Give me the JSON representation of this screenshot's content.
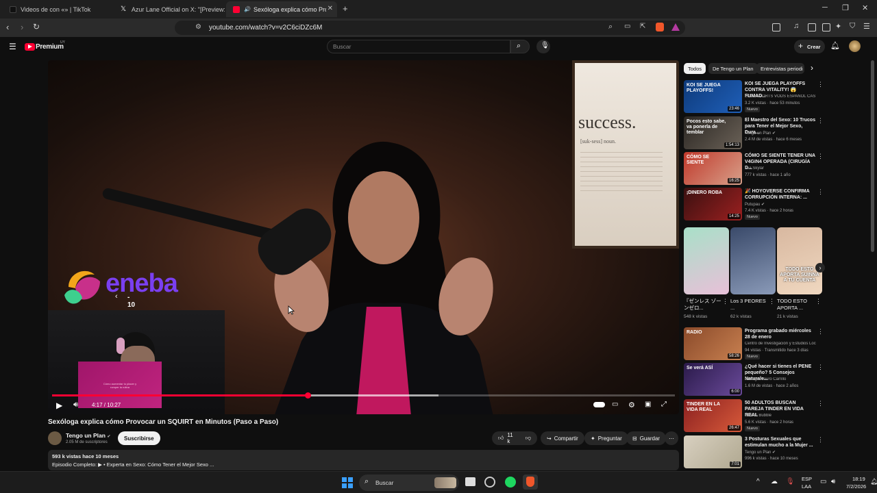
{
  "tabs": [
    {
      "title": "Videos de con «» | TikTok",
      "active": false
    },
    {
      "title": "Azur Lane Official on X: \"[Preview: Fr",
      "active": false
    },
    {
      "title": "Sexóloga explica cómo Provoc",
      "active": true
    }
  ],
  "address": {
    "url": "youtube.com/watch?v=v2C6ciDZc6M"
  },
  "yt": {
    "brand": "Premium",
    "region": "UY",
    "search_placeholder": "Buscar",
    "create_label": "Crear"
  },
  "video": {
    "poster_text": "success.",
    "poster_sub": "[suk-sess] noun.",
    "overlay_brand": "eneba",
    "skip_label": "- 10",
    "pink_text": "Cómo aumentar tu placer y romper la rutina",
    "time": "4:17 / 10:27",
    "progress": 0.41,
    "buffered": 0.62,
    "title": "Sexóloga explica cómo Provocar un SQUIRT en Minutos (Paso a Paso)"
  },
  "channel": {
    "name": "Tengo un Plan",
    "subs": "2.05 M de suscriptores",
    "subscribe_label": "Suscribirse"
  },
  "actions": {
    "likes": "11 k",
    "share": "Compartir",
    "ask": "Preguntar",
    "save": "Guardar"
  },
  "description": {
    "stats": "593 k vistas  hace 10 meses",
    "line": "Episodio Completo: ▶ • Experta en Sexo: Cómo Tener el Mejor Sexo ..."
  },
  "chips": [
    "Todos",
    "De Tengo un Plan",
    "Entrevistas periodi"
  ],
  "recs_top": [
    {
      "title": "KOI SE JUEGA PLAYOFFS CONTRA VITALITY! 😱FUMAD...",
      "channel": "LOL ESPORTS VODS ESPAÑOL CASTEO...",
      "views": "3.2 K vistas · hace 53 minutos",
      "badge": "Nuevo",
      "dur": "23:46",
      "thumb_text": "KOI SE JUEGA PLAYOFFS!",
      "colors": [
        "#0e3a7a",
        "#1f5fb8"
      ]
    },
    {
      "title": "El Maestro del Sexo: 10 Trucos para Tener el Mejor Sexo, Dura...",
      "channel": "Tengo un Plan ✔",
      "views": "2.4 M de vistas · hace 6 meses",
      "badge": "",
      "dur": "1:54:13",
      "thumb_text": "Pocos esto sabe, va ponerla de temblar",
      "colors": [
        "#2a2622",
        "#6b6258"
      ]
    },
    {
      "title": "CÓMO SE SIENTE TENER UNA V4GIN4 OPERADA (CIRUGÍA D...",
      "channel": "Mia Skylar",
      "views": "777 k vistas · hace 1 año",
      "badge": "",
      "dur": "16:25",
      "thumb_text": "CÓMO SE SIENTE",
      "colors": [
        "#c0392b",
        "#d8a08a"
      ]
    },
    {
      "title": "🎉 HOYOVERSE CONFIRMA CORRUPCIÓN INTERNA: ...",
      "channel": "Putupau ✔",
      "views": "7.4 K vistas · hace 2 horas",
      "badge": "Nuevo",
      "dur": "14:25",
      "thumb_text": "¡DINERO ROBA",
      "colors": [
        "#3a1010",
        "#9b2020"
      ]
    }
  ],
  "shorts": [
    {
      "title": "『ゼンレス ゾーンゼロ...",
      "views": "548 k vistas",
      "colors": [
        "#a8e0c8",
        "#e8c0d8"
      ]
    },
    {
      "title": "Los 3 PEORES ...",
      "views": "62 k vistas",
      "colors": [
        "#3a4a6a",
        "#8a9ab8"
      ]
    },
    {
      "title": "TODO ESTO APORTA ...",
      "views": "21 k vistas",
      "colors": [
        "#d8b8a0",
        "#f0d8c0"
      ],
      "overlay": "TODO ESTO APORTA SUINNA A TU CUENTA"
    }
  ],
  "recs_bottom": [
    {
      "title": "Programa grabado miércoles 28 de enero",
      "channel": "Centro de Investigación y Estudios Loca...",
      "views": "94 vistas · Transmitido hace 3 días",
      "badge": "Nuevo",
      "dur": "58:26",
      "thumb_text": "RADIO",
      "colors": [
        "#8a4a2a",
        "#c88050"
      ]
    },
    {
      "title": "¿Qué hacer si tienes el PENE pequeño? 5 Consejos Naturale...",
      "channel": "Urólogo Mauro Carrillo",
      "views": "1.6 M de vistas · hace 2 años",
      "badge": "",
      "dur": "6:00",
      "thumb_text": "Se verá ASÍ",
      "colors": [
        "#2a1a4a",
        "#6a4a9a"
      ]
    },
    {
      "title": "50 ADULTOS BUSCAN PAREJA TINDER EN VIDA REAL",
      "channel": "Somos Bubble",
      "views": "5.6 K vistas · hace 2 horas",
      "badge": "Nuevo",
      "dur": "26:47",
      "thumb_text": "TINDER EN LA VIDA REAL",
      "colors": [
        "#8a2020",
        "#d85a3a"
      ]
    },
    {
      "title": "3 Posturas Sexuales que estimulan mucho a la Mujer ...",
      "channel": "Tengo un Plan ✔",
      "views": "996 k vistas · hace 10 meses",
      "badge": "",
      "dur": "7:01",
      "thumb_text": "",
      "colors": [
        "#d8d0c0",
        "#b0a890"
      ]
    }
  ],
  "taskbar": {
    "search": "Buscar",
    "lang": "ESP",
    "layout": "LAA",
    "time": "18:19",
    "date": "7/2/2026"
  }
}
